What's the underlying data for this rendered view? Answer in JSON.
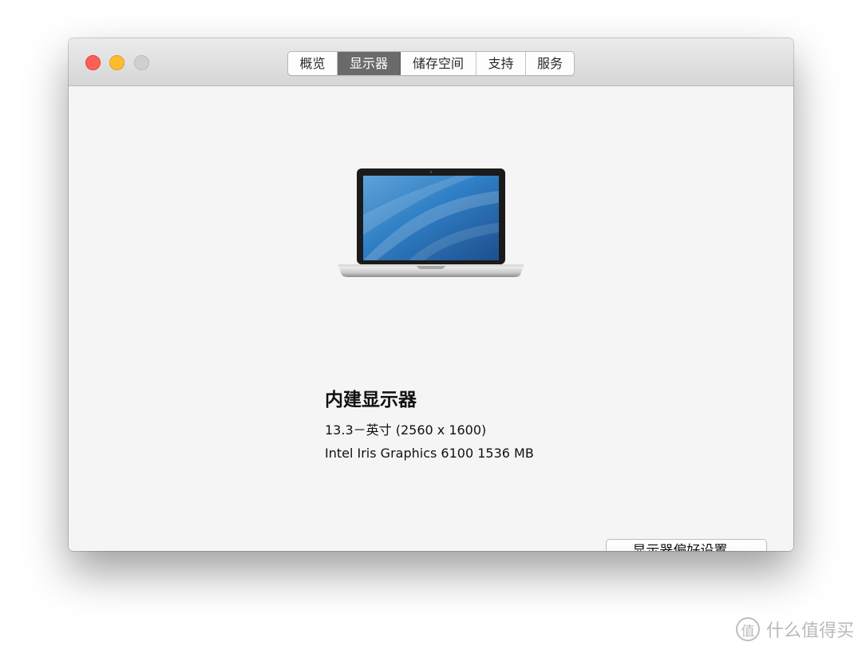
{
  "window": {
    "controls": {
      "close": "close-button",
      "minimize": "minimize-button",
      "zoom": "zoom-button"
    },
    "colors": {
      "close": "#fc5f57",
      "minimize": "#fdbc2e",
      "zoom": "#cfcfcf"
    }
  },
  "tabs": [
    {
      "label": "概览"
    },
    {
      "label": "显示器",
      "selected": true
    },
    {
      "label": "储存空间"
    },
    {
      "label": "支持"
    },
    {
      "label": "服务"
    }
  ],
  "display": {
    "icon": "macbook-pro-icon",
    "name": "内建显示器",
    "size": "13.3－英寸 (2560 x 1600)",
    "graphics": "Intel Iris Graphics 6100 1536 MB"
  },
  "preferences_button": {
    "label": "显示器偏好设置..."
  },
  "watermark": {
    "logo_glyph": "值",
    "text": "什么值得买"
  }
}
